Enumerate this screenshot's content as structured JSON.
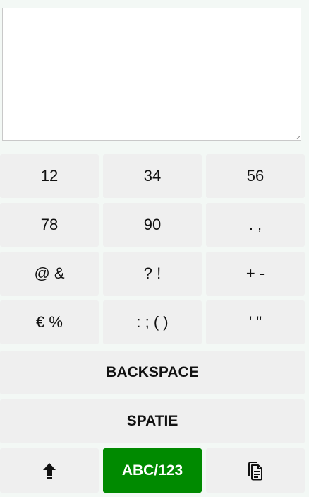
{
  "input": {
    "value": "",
    "placeholder": ""
  },
  "keys": {
    "row1": [
      "12",
      "34",
      "56"
    ],
    "row2": [
      "78",
      "90",
      ". ,"
    ],
    "row3": [
      "@ &",
      "? !",
      "+ -"
    ],
    "row4": [
      "€ %",
      ": ; ( )",
      "' \""
    ]
  },
  "backspace_label": "BACKSPACE",
  "space_label": "SPATIE",
  "mode_label": "ABC/123",
  "icons": {
    "shift": "arrow-up-icon",
    "paste": "copy-paste-icon"
  },
  "colors": {
    "mode_button": "#008a00",
    "key_background": "#efefef",
    "page_background": "#f3f8f5"
  }
}
